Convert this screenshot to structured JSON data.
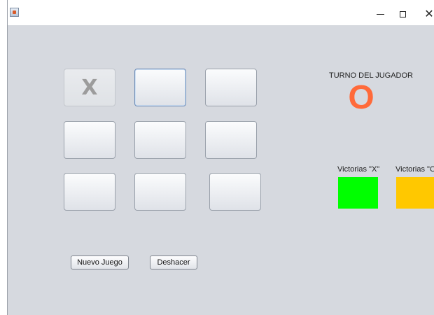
{
  "window": {
    "title": "",
    "min_glyph": "–",
    "max_glyph": "□",
    "close_glyph": "✕"
  },
  "board": {
    "cells": [
      {
        "value": "X",
        "state": "disabled"
      },
      {
        "value": "",
        "state": "focused"
      },
      {
        "value": "",
        "state": "normal"
      },
      {
        "value": "",
        "state": "normal"
      },
      {
        "value": "",
        "state": "normal"
      },
      {
        "value": "",
        "state": "normal"
      },
      {
        "value": "",
        "state": "normal"
      },
      {
        "value": "",
        "state": "normal"
      },
      {
        "value": "",
        "state": "normal"
      }
    ]
  },
  "turn": {
    "label": "TURNO DEL JUGADOR",
    "value": "O",
    "color": "#ff6a3a"
  },
  "wins": {
    "x_label": "Victorias \"X\"",
    "o_label": "Victorias \"O\"",
    "x_color": "#00ff00",
    "o_color": "#ffc800"
  },
  "actions": {
    "new_game": "Nuevo Juego",
    "undo": "Deshacer"
  },
  "icons": {
    "app": "java-app-icon",
    "minimize": "minimize-icon",
    "maximize": "maximize-icon",
    "close": "close-icon"
  }
}
